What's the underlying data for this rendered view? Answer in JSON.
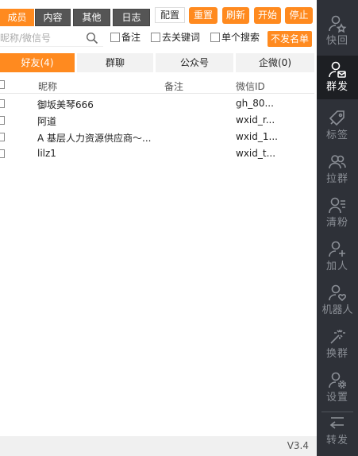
{
  "top_tabs": [
    {
      "label": "成员",
      "active": true
    },
    {
      "label": "内容",
      "active": false
    },
    {
      "label": "其他",
      "active": false
    },
    {
      "label": "日志",
      "active": false
    },
    {
      "label": "配置",
      "active": false
    }
  ],
  "actions": {
    "reset": "重置",
    "refresh": "刷新",
    "start": "开始",
    "stop": "停止"
  },
  "search": {
    "placeholder": "昵称/微信号",
    "note_label": "备注",
    "keyword_label": "去关键词",
    "single_label": "单个搜索",
    "no_send_button": "不发名单"
  },
  "category_tabs": [
    {
      "label": "好友(4)",
      "active": true
    },
    {
      "label": "群聊",
      "active": false
    },
    {
      "label": "公众号",
      "active": false
    },
    {
      "label": "企微(0)",
      "active": false
    }
  ],
  "table": {
    "headers": [
      "昵称",
      "备注",
      "微信ID"
    ],
    "rows": [
      {
        "nickname": "御坂美琴666",
        "note": "",
        "wxid": "gh_80..."
      },
      {
        "nickname": "阿道",
        "note": "",
        "wxid": "wxid_r..."
      },
      {
        "nickname": "A 基层人力资源供应商～...",
        "note": "",
        "wxid": "wxid_1..."
      },
      {
        "nickname": "lilz1",
        "note": "",
        "wxid": "wxid_t..."
      }
    ]
  },
  "sidebar": {
    "items": [
      {
        "label": "快回",
        "icon": "user-star-icon",
        "active": false
      },
      {
        "label": "群发",
        "icon": "user-send-icon",
        "active": true
      },
      {
        "label": "标签",
        "icon": "tag-icon",
        "active": false
      },
      {
        "label": "拉群",
        "icon": "group-icon",
        "active": false
      },
      {
        "label": "清粉",
        "icon": "user-list-icon",
        "active": false
      },
      {
        "label": "加人",
        "icon": "user-plus-icon",
        "active": false
      },
      {
        "label": "机器人",
        "icon": "user-heart-icon",
        "active": false
      },
      {
        "label": "换群",
        "icon": "magic-wand-icon",
        "active": false
      },
      {
        "label": "设置",
        "icon": "user-gear-icon",
        "active": false
      },
      {
        "label": "转发",
        "icon": "forward-icon",
        "active": false
      }
    ]
  },
  "footer": {
    "version": "V3.4"
  },
  "colors": {
    "accent": "#ff8a1f",
    "sidebar_bg": "#2e3138",
    "sidebar_active": "#1d1f23",
    "tab_dark": "#555555"
  }
}
